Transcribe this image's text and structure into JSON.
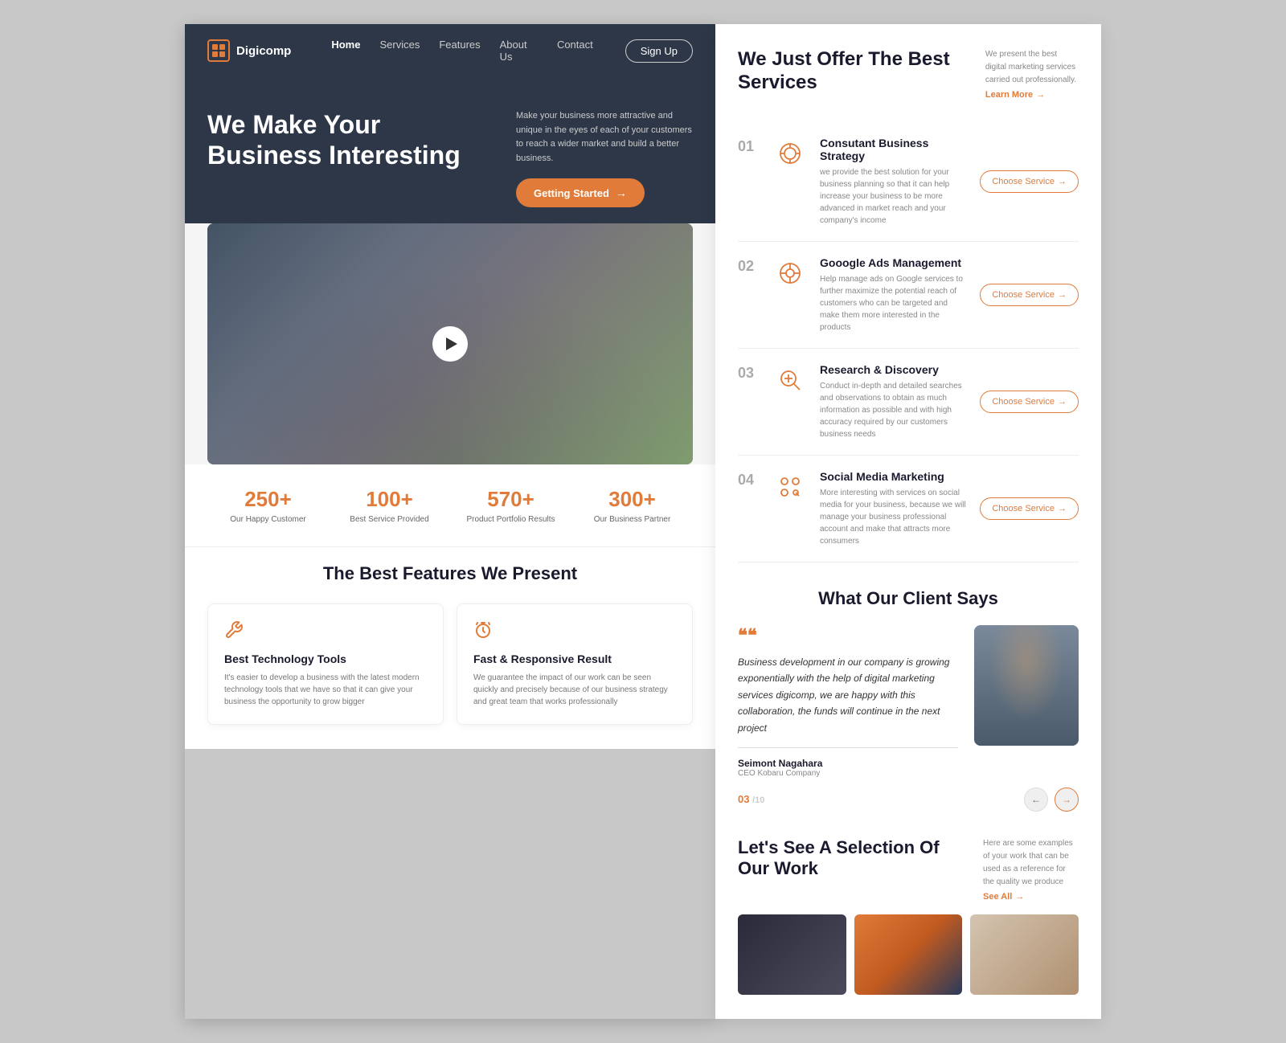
{
  "brand": {
    "name": "Digicomp"
  },
  "nav": {
    "links": [
      {
        "label": "Home",
        "active": true
      },
      {
        "label": "Services",
        "active": false
      },
      {
        "label": "Features",
        "active": false
      },
      {
        "label": "About Us",
        "active": false
      },
      {
        "label": "Contact",
        "active": false
      }
    ],
    "signup_label": "Sign Up"
  },
  "hero": {
    "title": "We Make Your Business Interesting",
    "description": "Make your business more attractive and unique in the eyes of each of your customers to reach a wider market and build a better business.",
    "cta_label": "Getting Started"
  },
  "stats": [
    {
      "number": "250+",
      "label": "Our Happy Customer"
    },
    {
      "number": "100+",
      "label": "Best Service Provided"
    },
    {
      "number": "570+",
      "label": "Product Portfolio Results"
    },
    {
      "number": "300+",
      "label": "Our Business Partner"
    }
  ],
  "features": {
    "title": "The Best Features We Present",
    "items": [
      {
        "icon": "wrench",
        "name": "Best Technology Tools",
        "description": "It's easier to develop a business with the latest modern technology tools that we have so that it can give your business the opportunity to grow bigger"
      },
      {
        "icon": "timer",
        "name": "Fast & Responsive Result",
        "description": "We guarantee the impact of our work can be seen quickly and precisely because of our business strategy and great team that works professionally"
      }
    ]
  },
  "services_section": {
    "title": "We Just Offer The Best Services",
    "description": "We present the best digital marketing services carried out professionally.",
    "learn_more": "Learn More",
    "items": [
      {
        "number": "01",
        "icon": "target",
        "name": "Consutant Business Strategy",
        "description": "we provide the best solution for your business planning so that it can help increase your business to be more advanced in market reach and your company's income"
      },
      {
        "number": "02",
        "icon": "google",
        "name": "Gooogle Ads Management",
        "description": "Help manage ads on Google services to further maximize the potential reach of customers who can be targeted and make them more interested in the products"
      },
      {
        "number": "03",
        "icon": "search",
        "name": "Research & Discovery",
        "description": "Conduct in-depth and detailed searches and observations to obtain as much information as possible and with high accuracy required by our customers business needs"
      },
      {
        "number": "04",
        "icon": "social",
        "name": "Social Media Marketing",
        "description": "More interesting with services on social media for your business, because we will manage your business professional account and make that attracts more consumers"
      }
    ],
    "choose_btn": "Choose Service"
  },
  "testimonial": {
    "title": "What Our Client Says",
    "quote": "Business development in our company is growing exponentially with the help of digital marketing services digicomp, we are happy with this collaboration, the funds will continue in the next project",
    "author": "Seimont Nagahara",
    "role": "CEO Kobaru Company",
    "current": "03",
    "total": "10"
  },
  "portfolio": {
    "title": "Let's See A Selection Of Our Work",
    "description": "Here are some examples of your work that can be used as a reference for the quality we produce",
    "see_all": "See All"
  }
}
